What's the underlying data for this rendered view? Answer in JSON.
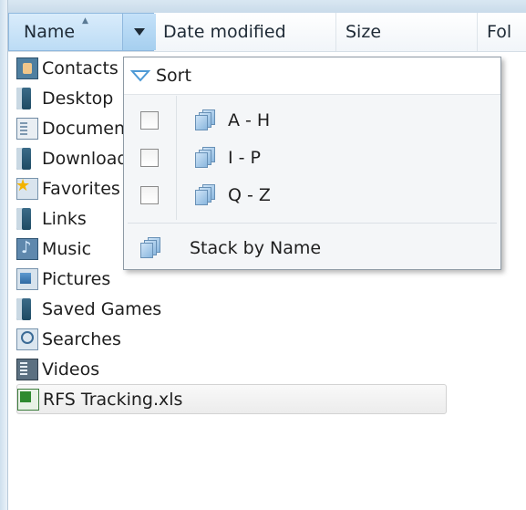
{
  "columns": {
    "name": "Name",
    "date_modified": "Date modified",
    "size": "Size",
    "folder_partial": "Fol"
  },
  "files": [
    {
      "label": "Contacts",
      "icon": "contacts-icon"
    },
    {
      "label": "Desktop",
      "icon": "folder-icon"
    },
    {
      "label": "Documents",
      "icon": "document-folder-icon"
    },
    {
      "label": "Downloads",
      "icon": "folder-icon"
    },
    {
      "label": "Favorites",
      "icon": "favorites-icon"
    },
    {
      "label": "Links",
      "icon": "folder-icon"
    },
    {
      "label": "Music",
      "icon": "music-icon"
    },
    {
      "label": "Pictures",
      "icon": "pictures-icon"
    },
    {
      "label": "Saved Games",
      "icon": "folder-icon"
    },
    {
      "label": "Searches",
      "icon": "searches-icon"
    },
    {
      "label": "Videos",
      "icon": "videos-icon"
    },
    {
      "label": "RFS Tracking.xls",
      "icon": "excel-file-icon",
      "selected": true
    }
  ],
  "menu": {
    "sort_label": "Sort",
    "filters": [
      {
        "label": "A - H",
        "checked": false
      },
      {
        "label": "I - P",
        "checked": false
      },
      {
        "label": "Q - Z",
        "checked": false
      }
    ],
    "stack_label": "Stack by Name"
  }
}
